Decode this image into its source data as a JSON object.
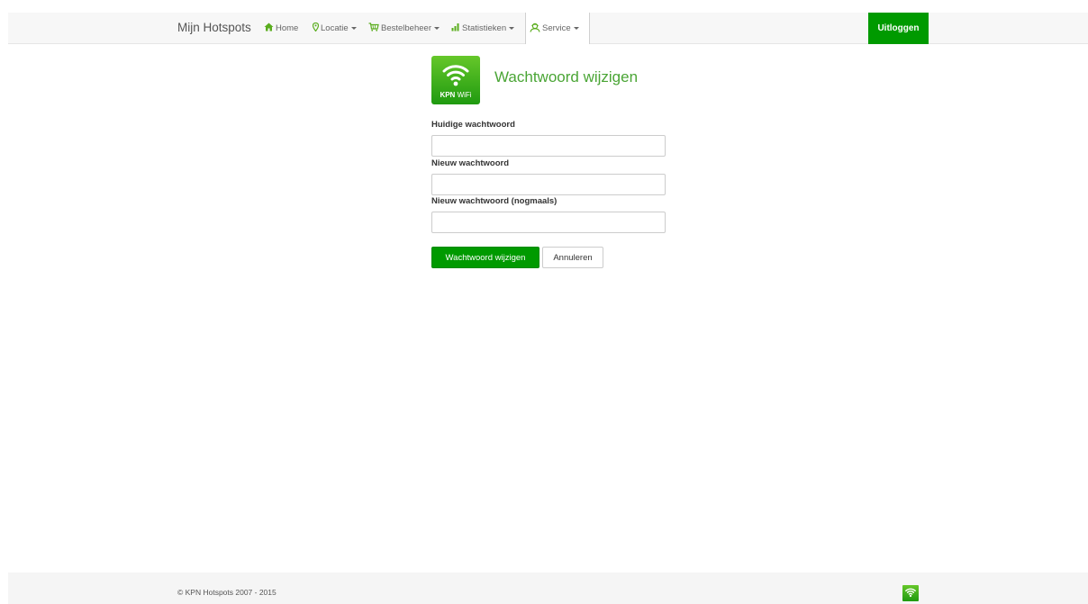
{
  "nav": {
    "brand": "Mijn Hotspots",
    "items": [
      {
        "label": "Home",
        "icon": "home-icon"
      },
      {
        "label": "Locatie",
        "icon": "map-marker-icon"
      },
      {
        "label": "Bestelbeheer",
        "icon": "cart-icon"
      },
      {
        "label": "Statistieken",
        "icon": "bar-chart-icon"
      },
      {
        "label": "Service",
        "icon": "support-icon"
      }
    ],
    "logout": "Uitloggen"
  },
  "header": {
    "logo_kpn": "KPN",
    "logo_wifi": "WiFi",
    "title": "Wachtwoord wijzigen"
  },
  "form": {
    "current_label": "Huidige wachtwoord",
    "current_value": "",
    "new_label": "Nieuw wachtwoord",
    "new_value": "",
    "repeat_label": "Nieuw wachtwoord (nogmaals)",
    "repeat_value": "",
    "submit_label": "Wachtwoord wijzigen",
    "cancel_label": "Annuleren"
  },
  "footer": {
    "copyright": "© KPN Hotspots 2007 - 2015"
  },
  "colors": {
    "accent": "#009a00",
    "title": "#4aa535",
    "icon": "#5aad1e"
  }
}
